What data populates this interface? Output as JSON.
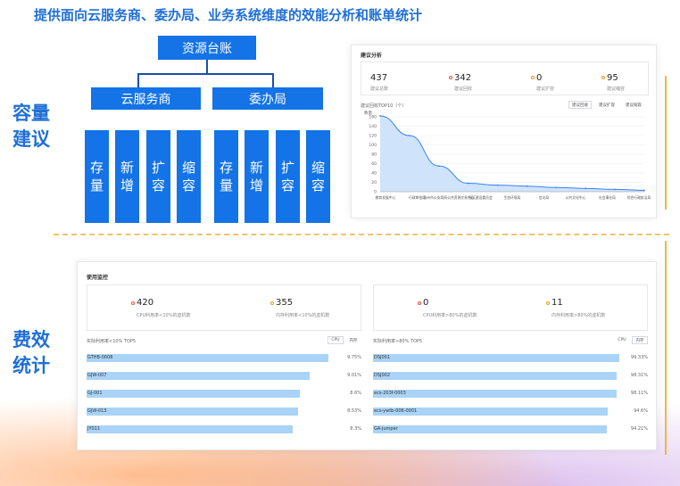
{
  "title": "提供面向云服务商、委办局、业务系统维度的效能分析和账单统计",
  "side_labels": {
    "capacity": [
      "容量",
      "建议"
    ],
    "cost": [
      "费效",
      "统计"
    ]
  },
  "org": {
    "root": "资源台账",
    "branches": [
      "云服务商",
      "委办局"
    ],
    "leaves": [
      [
        "存",
        "量"
      ],
      [
        "新",
        "增"
      ],
      [
        "扩",
        "容"
      ],
      [
        "缩",
        "容"
      ],
      [
        "存",
        "量"
      ],
      [
        "新",
        "增"
      ],
      [
        "扩",
        "容"
      ],
      [
        "缩",
        "容"
      ]
    ]
  },
  "suggest": {
    "title": "建议分析",
    "stats": [
      {
        "value": "437",
        "label": "建议总数",
        "dot": "red"
      },
      {
        "value": "342",
        "label": "建议回收",
        "dot": "red"
      },
      {
        "value": "0",
        "label": "建议扩容",
        "dot": "orange"
      },
      {
        "value": "95",
        "label": "建议缩容",
        "dot": "orange"
      }
    ],
    "chart_title": "建议回收TOP10（个）",
    "tabs": [
      "建议回收",
      "建议扩容",
      "建议缩容"
    ]
  },
  "chart_data": {
    "type": "area",
    "title": "建议回收TOP10（个）",
    "ylabel": "数量",
    "categories": [
      "教育发展中心",
      "行政审批局",
      "苏州市公安局",
      "民政",
      "城管",
      "发改",
      "住建",
      "公共文化中心",
      "社会事业局",
      "综合行政执法局"
    ],
    "x_tick_labels": [
      "教育发展中心",
      "行政审批局",
      "苏州市公安局网公共资源交易中心",
      "园区建设委员会",
      "生态环境局",
      "信访局",
      "公共文化中心",
      "社会事业局",
      "综合行政执法局"
    ],
    "values": [
      162,
      120,
      55,
      18,
      14,
      12,
      9,
      7,
      5,
      3
    ],
    "yticks": [
      0,
      20,
      40,
      60,
      80,
      100,
      120,
      140,
      160
    ],
    "ylim": [
      0,
      160
    ],
    "color": "#3b82f6",
    "fill": "#cfe3fb"
  },
  "usage": {
    "title": "使用监控",
    "left": {
      "stats": [
        {
          "value": "420",
          "label": "CPU利用率<10%的虚机数",
          "dot": "red"
        },
        {
          "value": "355",
          "label": "内存利用率<10%的虚机数",
          "dot": "orange"
        }
      ],
      "list_title": "实际利用率<10% TOP5",
      "toggles": [
        "CPU",
        "内存"
      ],
      "rows": [
        {
          "name": "GTHB-0008",
          "pct": "9.75%",
          "ratio": 0.975
        },
        {
          "name": "GJW-007",
          "pct": "9.01%",
          "ratio": 0.901
        },
        {
          "name": "GJ-001",
          "pct": "8.6%",
          "ratio": 0.86
        },
        {
          "name": "GJW-013",
          "pct": "8.53%",
          "ratio": 0.853
        },
        {
          "name": "JY011",
          "pct": "8.3%",
          "ratio": 0.83
        }
      ]
    },
    "right": {
      "stats": [
        {
          "value": "0",
          "label": "CPU利用率>80%的虚机数",
          "dot": "red"
        },
        {
          "value": "11",
          "label": "内存利用率>80%的虚机数",
          "dot": "orange"
        }
      ],
      "list_title": "实际利用率>80% TOP5",
      "toggles": [
        "CPU",
        "内存"
      ],
      "rows": [
        {
          "name": "DSJ001",
          "pct": "99.33%",
          "ratio": 0.9933
        },
        {
          "name": "DSJ002",
          "pct": "98.31%",
          "ratio": 0.9831
        },
        {
          "name": "ecs-203f-0003",
          "pct": "98.11%",
          "ratio": 0.9811
        },
        {
          "name": "ecs-ywtb-006-0001",
          "pct": "94.6%",
          "ratio": 0.946
        },
        {
          "name": "GA-jumper",
          "pct": "94.21%",
          "ratio": 0.9421
        }
      ]
    }
  }
}
